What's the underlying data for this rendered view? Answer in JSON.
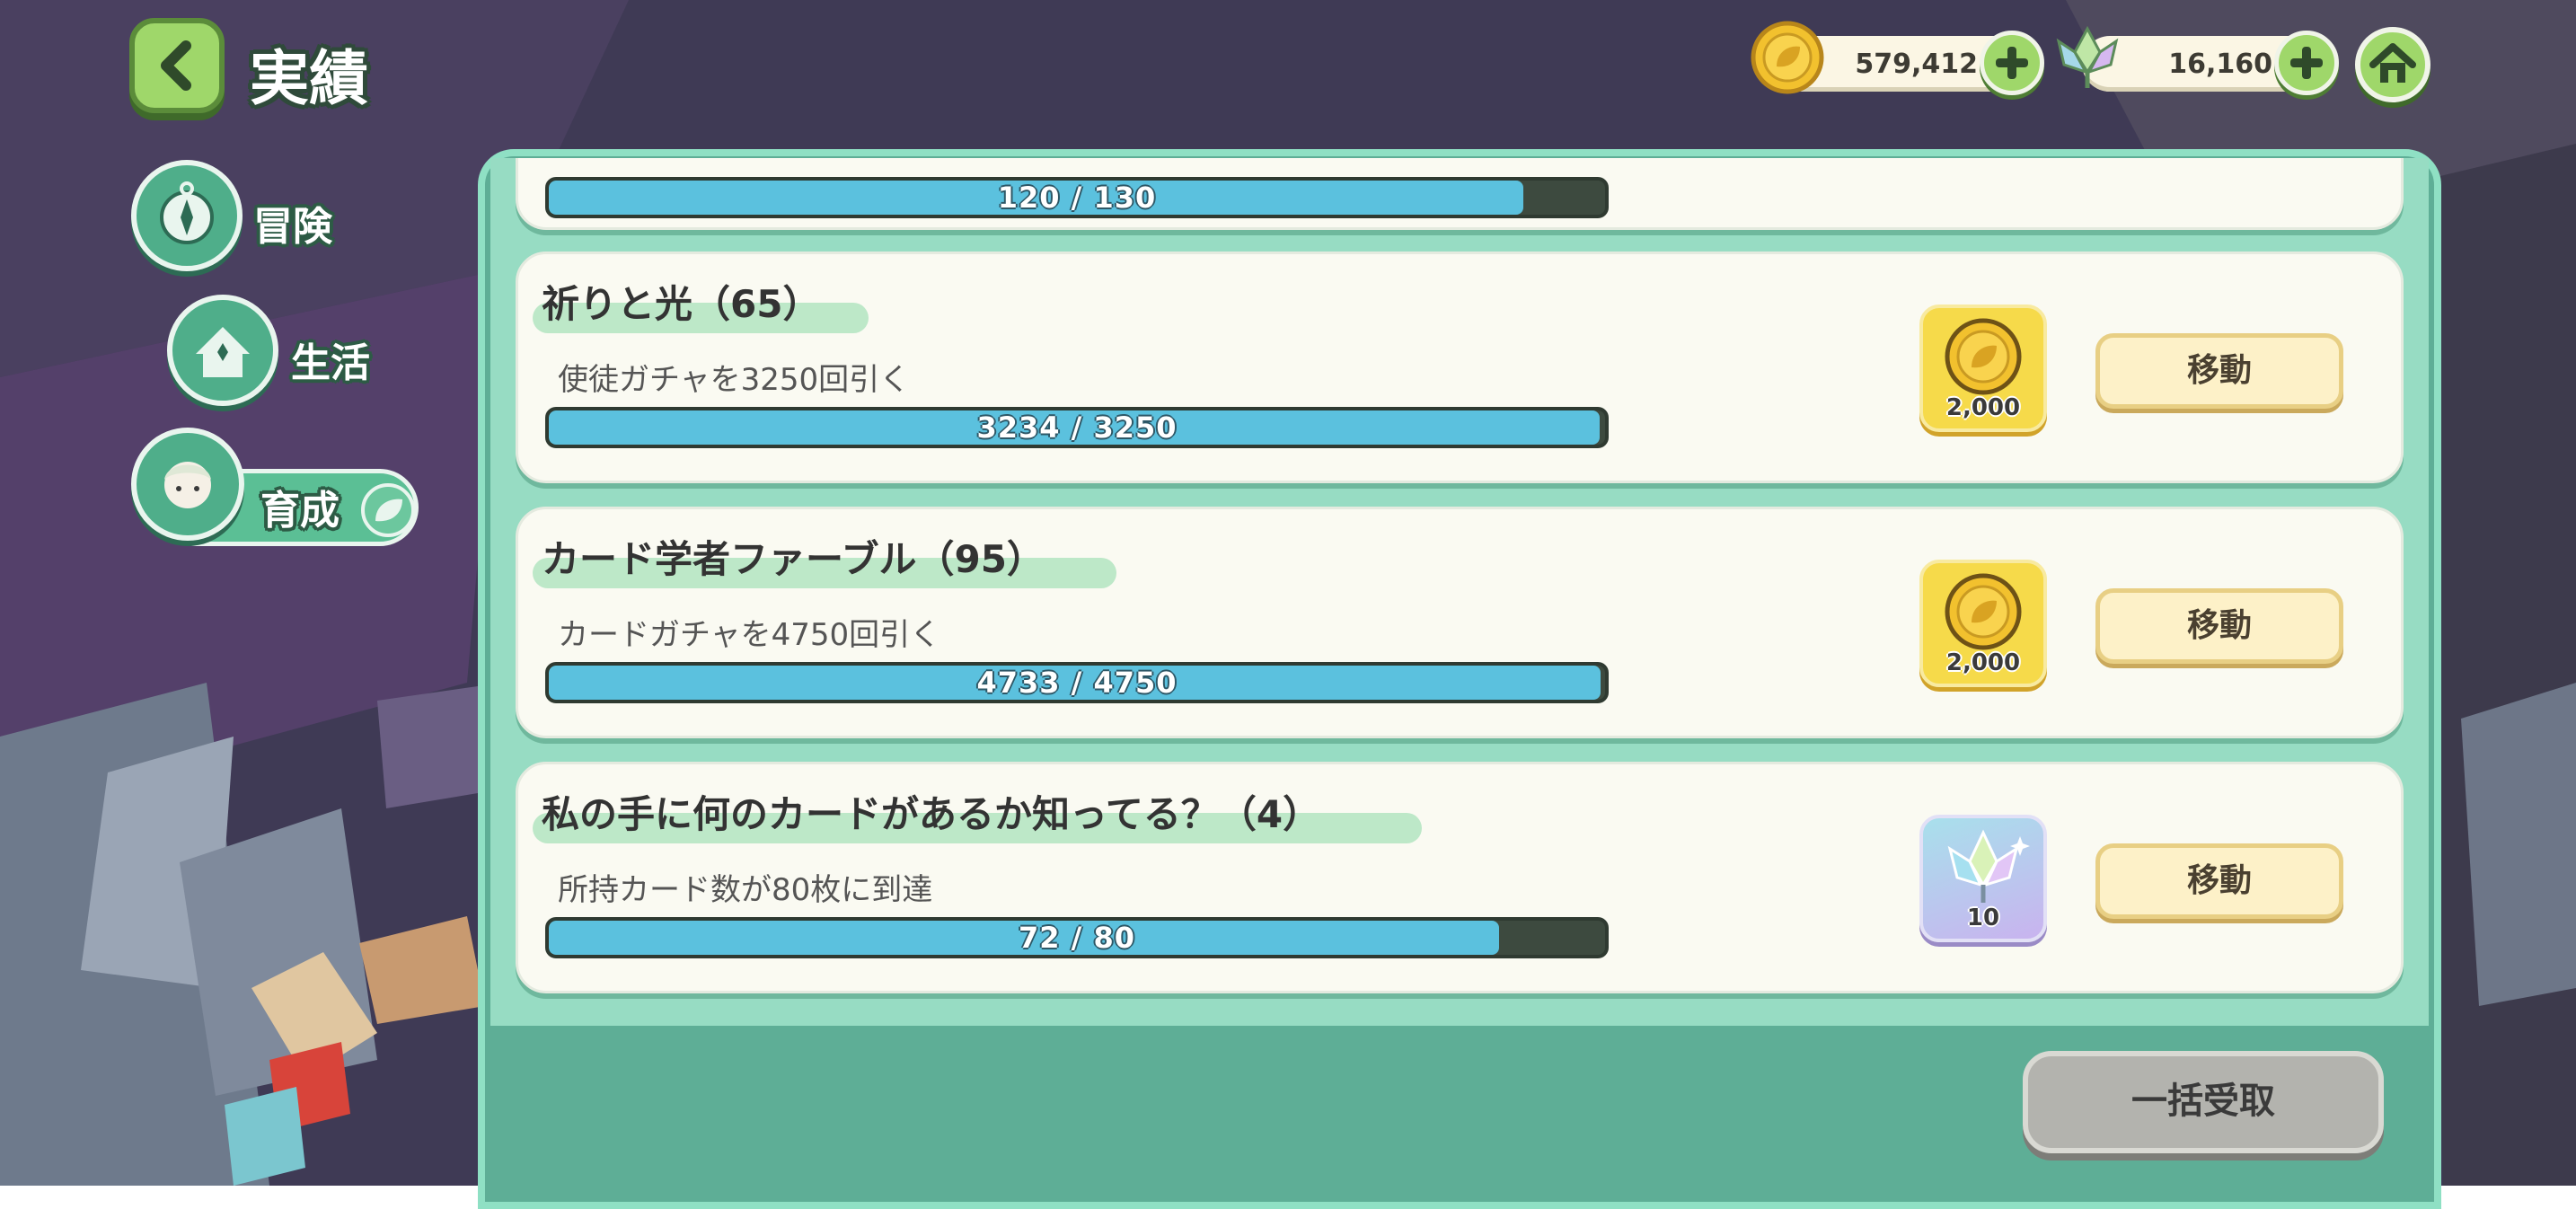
{
  "header": {
    "title": "実績",
    "gold": "579,412",
    "gems": "16,160"
  },
  "nav": [
    {
      "label": "冒険",
      "icon": "compass-icon"
    },
    {
      "label": "生活",
      "icon": "house-icon"
    },
    {
      "label": "育成",
      "icon": "character-icon"
    }
  ],
  "partial_item": {
    "progress": "120 / 130",
    "fill": 0.923
  },
  "items": [
    {
      "title": "祈りと光（65）",
      "desc": "使徒ガチャを3250回引く",
      "progress": "3234 / 3250",
      "fill": 0.995,
      "reward_type": "gold",
      "reward_amount": "2,000",
      "button": "移動"
    },
    {
      "title": "カード学者ファーブル（95）",
      "desc": "カードガチャを4750回引く",
      "progress": "4733 / 4750",
      "fill": 0.996,
      "reward_type": "gold",
      "reward_amount": "2,000",
      "button": "移動"
    },
    {
      "title": "私の手に何のカードがあるか知ってる？（4）",
      "desc": "所持カード数が80枚に到達",
      "progress": "72 / 80",
      "fill": 0.9,
      "reward_type": "gem",
      "reward_amount": "10",
      "button": "移動"
    }
  ],
  "footer": {
    "claim_all": "一括受取"
  }
}
